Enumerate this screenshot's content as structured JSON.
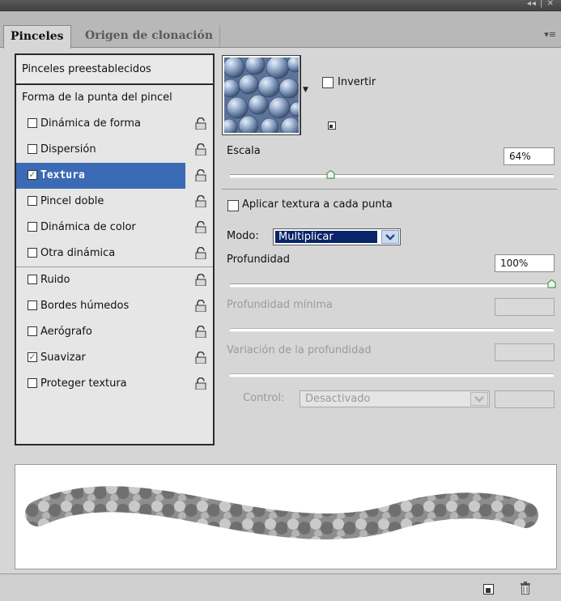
{
  "tabs": [
    {
      "label": "Pinceles",
      "active": true
    },
    {
      "label": "Origen de clonación",
      "active": false
    }
  ],
  "brush_list": {
    "preset_label": "Pinceles preestablecidos",
    "tip_shape_label": "Forma de la punta del pincel",
    "items": [
      {
        "label": "Dinámica de forma",
        "checked": false,
        "selected": false
      },
      {
        "label": "Dispersión",
        "checked": false,
        "selected": false
      },
      {
        "label": "Textura",
        "checked": true,
        "selected": true
      },
      {
        "label": "Pincel doble",
        "checked": false,
        "selected": false
      },
      {
        "label": "Dinámica de color",
        "checked": false,
        "selected": false
      },
      {
        "label": "Otra dinámica",
        "checked": false,
        "selected": false
      },
      {
        "label": "Ruido",
        "checked": false,
        "selected": false
      },
      {
        "label": "Bordes húmedos",
        "checked": false,
        "selected": false
      },
      {
        "label": "Aerógrafo",
        "checked": false,
        "selected": false
      },
      {
        "label": "Suavizar",
        "checked": true,
        "selected": false
      },
      {
        "label": "Proteger textura",
        "checked": false,
        "selected": false
      }
    ]
  },
  "texture": {
    "invert_label": "Invertir",
    "invert_checked": false,
    "scale_label": "Escala",
    "scale_value": "64%",
    "scale_fraction": 0.31,
    "apply_each_tip_label": "Aplicar textura a cada punta",
    "apply_each_tip_checked": false,
    "mode_label": "Modo:",
    "mode_value": "Multiplicar",
    "depth_label": "Profundidad",
    "depth_value": "100%",
    "depth_fraction": 1.0,
    "min_depth_label": "Profundidad mínima",
    "depth_jitter_label": "Variación de la profundidad",
    "control_label": "Control:",
    "control_value": "Desactivado"
  },
  "colors": {
    "selection": "#3b6bb5",
    "check": "#2b8a2b",
    "texture": "#8fa6c9"
  }
}
